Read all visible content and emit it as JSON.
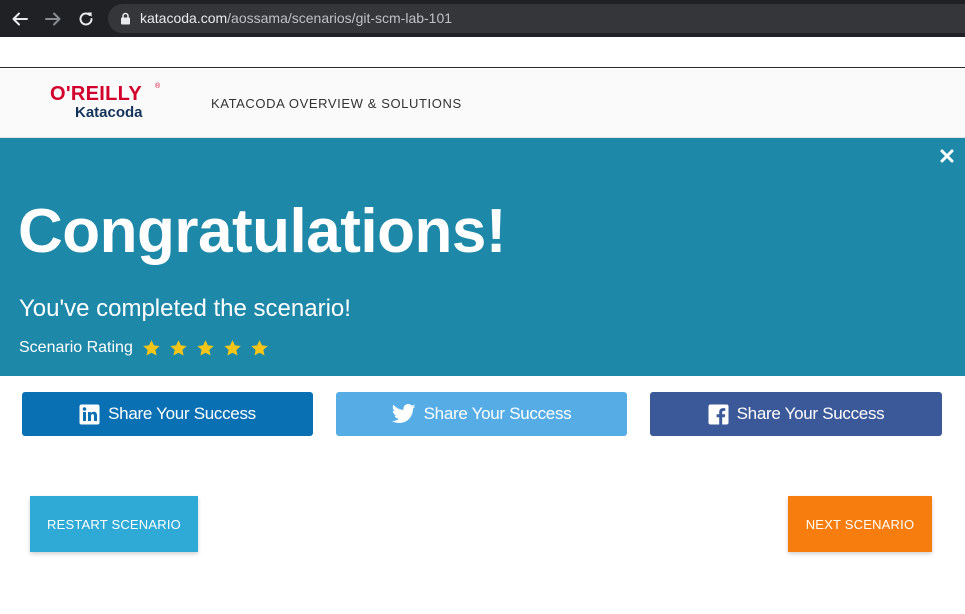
{
  "browser": {
    "url_host": "katacoda.com",
    "url_path": "/aossama/scenarios/git-scm-lab-101",
    "icons": [
      "back-arrow-icon",
      "forward-arrow-icon",
      "reload-icon",
      "lock-icon"
    ]
  },
  "header": {
    "logo_top": "O'REILLY",
    "logo_reg": "®",
    "logo_bottom": "Katacoda",
    "nav_link": "KATACODA OVERVIEW & SOLUTIONS"
  },
  "hero": {
    "title": "Congratulations!",
    "subtitle": "You've completed the scenario!",
    "rating_label": "Scenario Rating",
    "rating_stars": 5,
    "close_icon": "close-icon",
    "background": "#1e88a8",
    "star_color": "#f5c518"
  },
  "share": {
    "linkedin_label": "Share Your Success",
    "twitter_label": "Share Your Success",
    "facebook_label": "Share Your Success",
    "colors": {
      "linkedin": "#0a70b4",
      "twitter": "#56ade6",
      "facebook": "#3b5998"
    }
  },
  "actions": {
    "restart_label": "RESTART SCENARIO",
    "next_label": "NEXT SCENARIO",
    "colors": {
      "restart": "#2fa9d6",
      "next": "#f77d0e"
    }
  }
}
